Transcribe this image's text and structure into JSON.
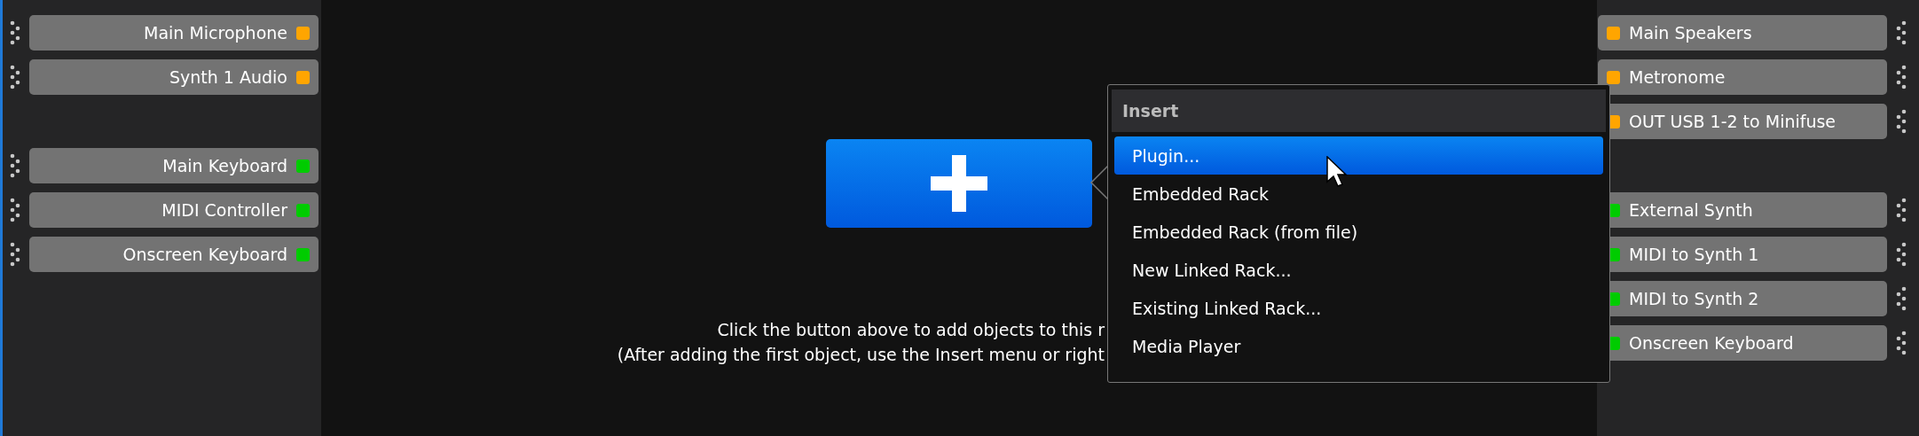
{
  "input_groups": [
    {
      "ports": [
        {
          "label": "Main Microphone",
          "color": "#ffa500"
        },
        {
          "label": "Synth 1 Audio",
          "color": "#ffa500"
        }
      ]
    },
    {
      "ports": [
        {
          "label": "Main Keyboard",
          "color": "#00cc00"
        },
        {
          "label": "MIDI Controller",
          "color": "#00cc00"
        },
        {
          "label": "Onscreen Keyboard",
          "color": "#00cc00"
        }
      ]
    }
  ],
  "output_groups": [
    {
      "ports": [
        {
          "label": "Main Speakers",
          "color": "#ffa500"
        },
        {
          "label": "Metronome",
          "color": "#ffa500"
        },
        {
          "label": "OUT USB 1-2 to Minifuse",
          "color": "#ffa500"
        }
      ]
    },
    {
      "ports": [
        {
          "label": "External Synth",
          "color": "#00cc00"
        },
        {
          "label": "MIDI to Synth 1",
          "color": "#00cc00"
        },
        {
          "label": "MIDI to Synth 2",
          "color": "#00cc00"
        },
        {
          "label": "Onscreen Keyboard",
          "color": "#00cc00"
        }
      ]
    }
  ],
  "hint_lines": [
    "Click the button above to add objects to this r",
    "(After adding the first object, use the Insert menu or right"
  ],
  "insert_menu": {
    "title": "Insert",
    "items": [
      {
        "label": "Plugin...",
        "selected": true
      },
      {
        "label": "Embedded Rack",
        "selected": false
      },
      {
        "label": "Embedded Rack (from file)",
        "selected": false
      },
      {
        "label": "New Linked Rack...",
        "selected": false
      },
      {
        "label": "Existing Linked Rack...",
        "selected": false
      },
      {
        "label": "Media Player",
        "selected": false
      }
    ]
  }
}
